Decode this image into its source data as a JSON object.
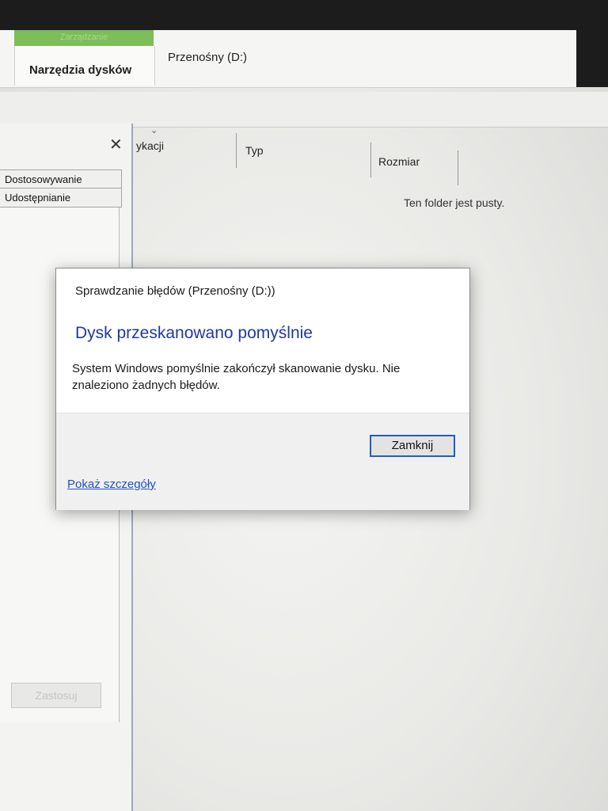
{
  "ribbon": {
    "contextual_tab_header": "Zarządzanie",
    "tab_label": "Narzędzia dysków",
    "drive_title": "Przenośny (D:)"
  },
  "filelist": {
    "columns": [
      "ykacji",
      "Typ",
      "Rozmiar"
    ],
    "empty_message": "Ten folder jest pusty."
  },
  "properties": {
    "close_glyph": "✕",
    "tabs": [
      "Dostosowywanie",
      "Udostępnianie"
    ],
    "apply_label": "Zastosuj"
  },
  "dialog": {
    "title": "Sprawdzanie błędów (Przenośny (D:))",
    "heading": "Dysk przeskanowano pomyślnie",
    "message": "System Windows pomyślnie zakończył skanowanie dysku. Nie znaleziono żadnych błędów.",
    "close_label": "Zamknij",
    "details_link": "Pokaż szczegóły"
  }
}
